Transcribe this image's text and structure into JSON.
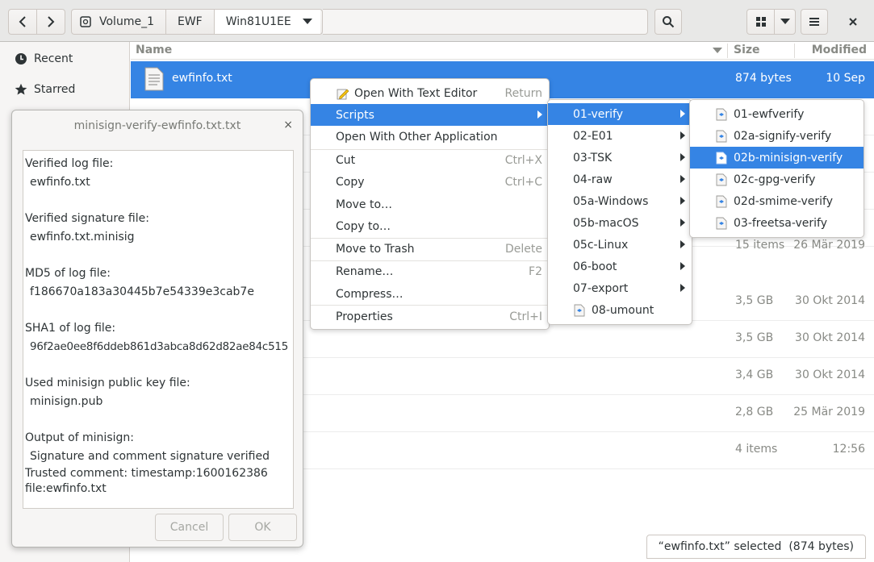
{
  "header": {
    "path_segments": [
      "Volume_1",
      "EWF",
      "Win81U1EE"
    ]
  },
  "sidebar": {
    "items": [
      {
        "label": "Recent",
        "icon": "clock-icon"
      },
      {
        "label": "Starred",
        "icon": "star-icon"
      }
    ]
  },
  "file_list": {
    "columns": {
      "name": "Name",
      "size": "Size",
      "modified": "Modified"
    },
    "rows": [
      {
        "name": "ewfinfo.txt",
        "size": "874 bytes",
        "modified": "10 Sep"
      },
      {
        "name": "",
        "size": "15 items",
        "modified": "26 Mär 2019"
      },
      {
        "name": "",
        "size": "3,5 GB",
        "modified": "30 Okt 2014"
      },
      {
        "name": "",
        "size": "3,5 GB",
        "modified": "30 Okt 2014"
      },
      {
        "name": "",
        "size": "3,4 GB",
        "modified": "30 Okt 2014"
      },
      {
        "name": "",
        "size": "2,8 GB",
        "modified": "25 Mär 2019"
      },
      {
        "name": "",
        "size": "4 items",
        "modified": "12:56"
      }
    ]
  },
  "status": {
    "text": "“ewfinfo.txt” selected  (874 bytes)"
  },
  "dialog": {
    "title": "minisign-verify-ewfinfo.txt.txt",
    "close": "×",
    "lines": [
      {
        "label": "Verified log file:",
        "value": "ewfinfo.txt"
      },
      {
        "label": "Verified signature file:",
        "value": "ewfinfo.txt.minisig"
      },
      {
        "label": "MD5 of log file:",
        "value": "f186670a183a30445b7e54339e3cab7e"
      },
      {
        "label": "SHA1 of log file:",
        "value": "96f2ae0ee8f6ddeb861d3abca8d62d82ae84c515"
      },
      {
        "label": "Used minisign public key file:",
        "value": "minisign.pub"
      },
      {
        "label": "Output of minisign:",
        "value": "Signature and comment signature verified"
      }
    ],
    "trailing": [
      "Trusted comment: timestamp:1600162386",
      "file:ewfinfo.txt"
    ],
    "cancel": "Cancel",
    "ok": "OK"
  },
  "context_menu": {
    "items": [
      {
        "label": "Open With Text Editor",
        "accel": "Return"
      },
      {
        "label": "Scripts",
        "accel": ""
      },
      {
        "label": "Open With Other Application",
        "accel": ""
      },
      {
        "label": "Cut",
        "accel": "Ctrl+X"
      },
      {
        "label": "Copy",
        "accel": "Ctrl+C"
      },
      {
        "label": "Move to…",
        "accel": ""
      },
      {
        "label": "Copy to…",
        "accel": ""
      },
      {
        "label": "Move to Trash",
        "accel": "Delete"
      },
      {
        "label": "Rename…",
        "accel": "F2"
      },
      {
        "label": "Compress…",
        "accel": ""
      },
      {
        "label": "Properties",
        "accel": "Ctrl+I"
      }
    ]
  },
  "scripts_menu": {
    "items": [
      "01-verify",
      "02-E01",
      "03-TSK",
      "04-raw",
      "05a-Windows",
      "05b-macOS",
      "05c-Linux",
      "06-boot",
      "07-export",
      "08-umount"
    ]
  },
  "verify_menu": {
    "items": [
      "01-ewfverify",
      "02a-signify-verify",
      "02b-minisign-verify",
      "02c-gpg-verify",
      "02d-smime-verify",
      "03-freetsa-verify"
    ]
  },
  "colors": {
    "accent": "#3584e4",
    "headerbar": "#e8e8e7",
    "sidebar": "#f6f5f4"
  }
}
